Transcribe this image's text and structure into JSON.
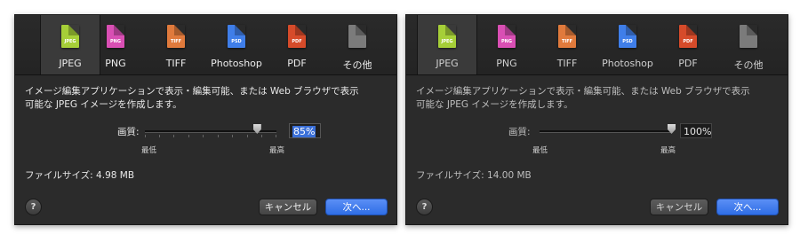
{
  "colors": {
    "jpeg": "#a6cf38",
    "png": "#d94fb4",
    "tiff": "#e07a3c",
    "psd": "#3f7ee9",
    "pdf": "#d64b2a",
    "other": "#7b7b7b",
    "accent": "#3a6fd8"
  },
  "left": {
    "tabs": [
      {
        "label": "JPEG",
        "ext": "JPEG",
        "icon": "jpeg-file-icon"
      },
      {
        "label": "PNG",
        "ext": "PNG",
        "icon": "png-file-icon"
      },
      {
        "label": "TIFF",
        "ext": "TIFF",
        "icon": "tiff-file-icon"
      },
      {
        "label": "Photoshop",
        "ext": "PSD",
        "icon": "psd-file-icon"
      },
      {
        "label": "PDF",
        "ext": "PDF",
        "icon": "pdf-file-icon"
      },
      {
        "label": "その他",
        "ext": "",
        "icon": "other-file-icon"
      }
    ],
    "description_line1": "イメージ編集アプリケーションで表示・編集可能、または Web ブラウザで表示",
    "description_line2": "可能な JPEG イメージを作成します。",
    "quality_label": "画質:",
    "min_label": "最低",
    "max_label": "最高",
    "quality_value": "85%",
    "quality_level": 0.85,
    "filesize": "ファイルサイズ: 4.98 MB",
    "help": "?",
    "cancel": "キャンセル",
    "next": "次へ..."
  },
  "right": {
    "tabs": [
      {
        "label": "JPEG",
        "ext": "JPEG",
        "icon": "jpeg-file-icon"
      },
      {
        "label": "PNG",
        "ext": "PNG",
        "icon": "png-file-icon"
      },
      {
        "label": "TIFF",
        "ext": "TIFF",
        "icon": "tiff-file-icon"
      },
      {
        "label": "Photoshop",
        "ext": "PSD",
        "icon": "psd-file-icon"
      },
      {
        "label": "PDF",
        "ext": "PDF",
        "icon": "pdf-file-icon"
      },
      {
        "label": "その他",
        "ext": "",
        "icon": "other-file-icon"
      }
    ],
    "description_line1": "イメージ編集アプリケーションで表示・編集可能、または Web ブラウザで表示",
    "description_line2": "可能な JPEG イメージを作成します。",
    "quality_label": "画質:",
    "min_label": "最低",
    "max_label": "最高",
    "quality_value": "100%",
    "quality_level": 1.0,
    "filesize": "ファイルサイズ: 14.00 MB",
    "help": "?",
    "cancel": "キャンセル",
    "next": "次へ..."
  }
}
